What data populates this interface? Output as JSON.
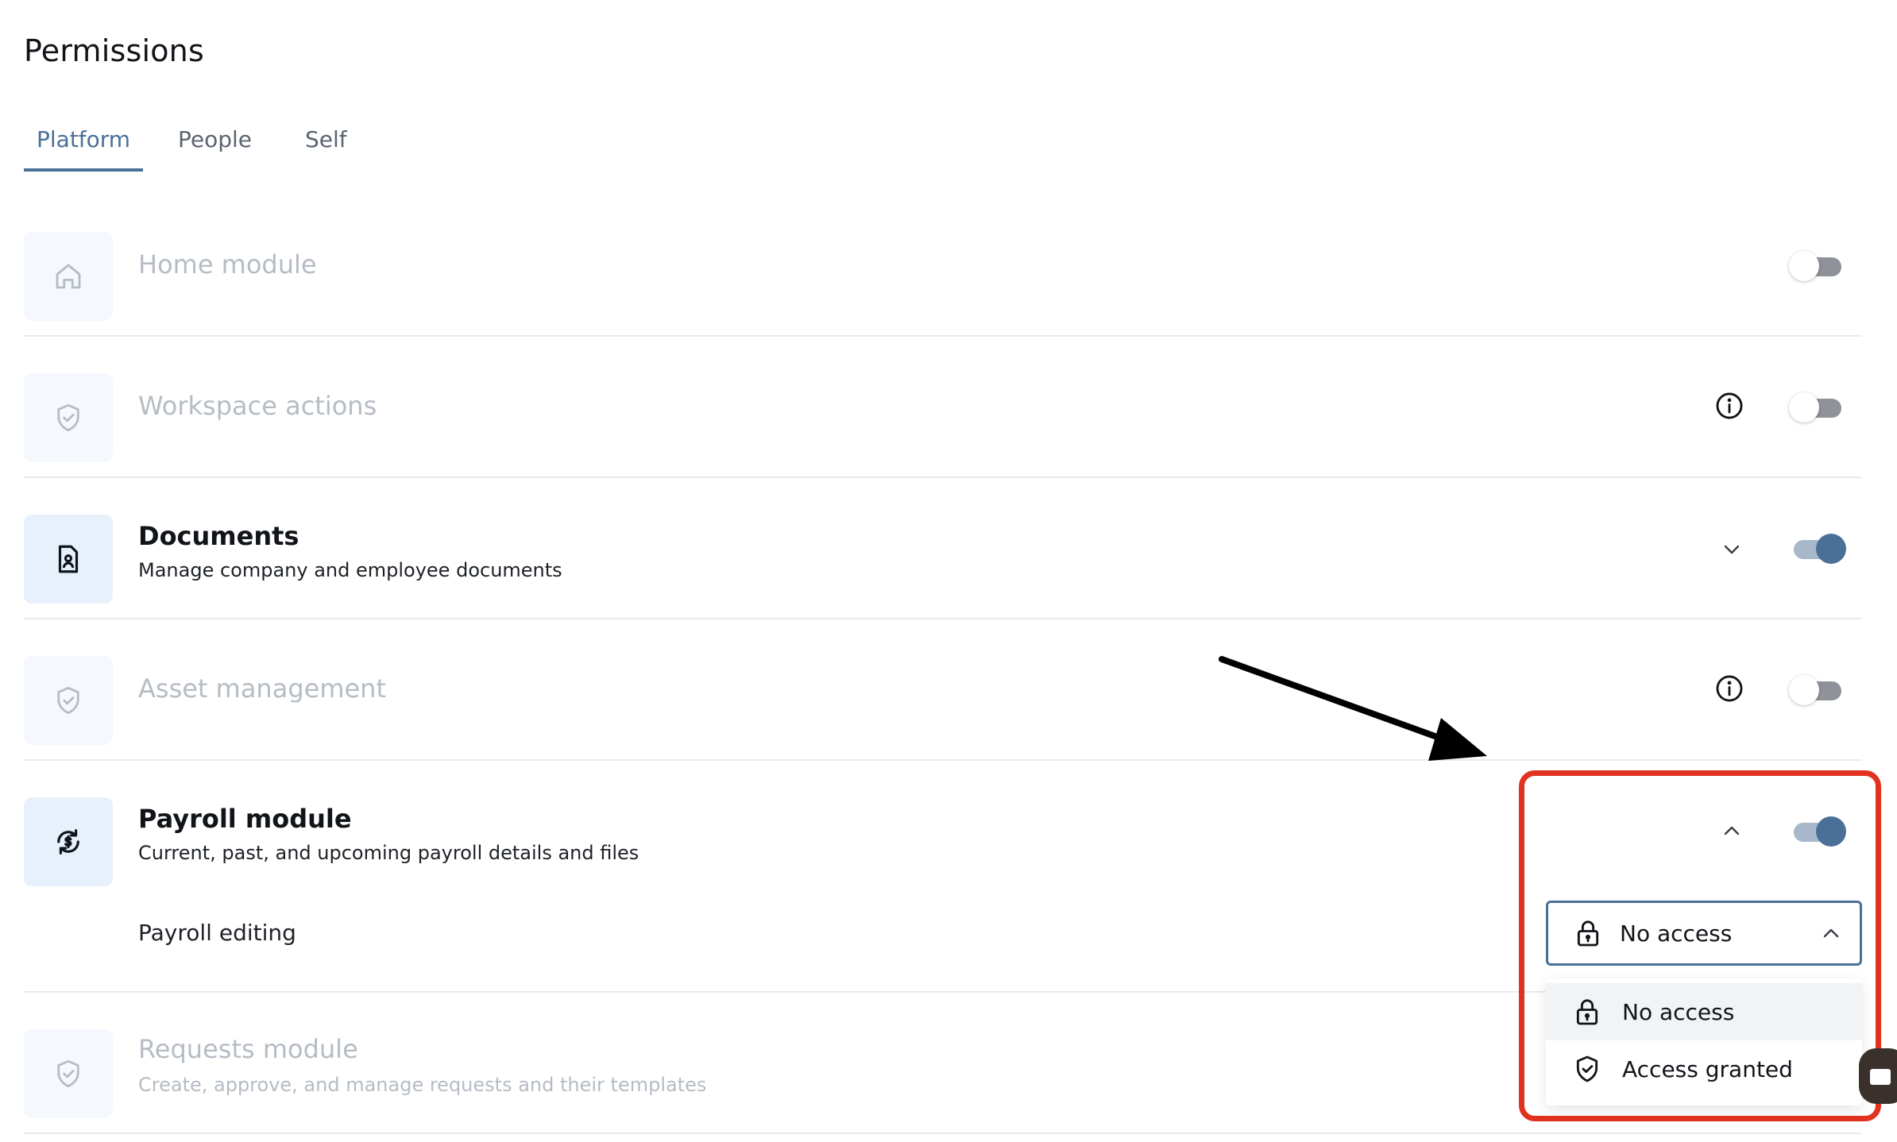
{
  "page": {
    "title": "Permissions"
  },
  "tabs": [
    {
      "label": "Platform",
      "active": true
    },
    {
      "label": "People",
      "active": false
    },
    {
      "label": "Self",
      "active": false
    }
  ],
  "modules": [
    {
      "name": "Home module",
      "description": "",
      "icon": "home-icon",
      "enabled": false,
      "control": "none"
    },
    {
      "name": "Workspace actions",
      "description": "",
      "icon": "shield-check-icon",
      "enabled": false,
      "control": "info"
    },
    {
      "name": "Documents",
      "description": "Manage company and employee documents",
      "icon": "document-person-icon",
      "enabled": true,
      "control": "chevron-down"
    },
    {
      "name": "Asset management",
      "description": "",
      "icon": "shield-check-icon",
      "enabled": false,
      "control": "info"
    },
    {
      "name": "Payroll module",
      "description": "Current, past, and upcoming payroll details and files",
      "icon": "payroll-refresh-icon",
      "enabled": true,
      "control": "chevron-up"
    },
    {
      "name": "Requests module",
      "description": "Create, approve, and manage requests and their templates",
      "icon": "shield-check-icon",
      "enabled": false,
      "control": "none"
    }
  ],
  "payroll_sub": {
    "label": "Payroll editing",
    "selected": "No access",
    "selected_icon": "lock-icon",
    "options": [
      {
        "label": "No access",
        "icon": "lock-icon",
        "highlighted": true
      },
      {
        "label": "Access granted",
        "icon": "shield-check-icon",
        "highlighted": false
      }
    ]
  },
  "annotation": {
    "arrow_color": "#000000",
    "box_color": "#e0321f"
  },
  "colors": {
    "accent": "#4a7098",
    "disabled_text": "#b6bcc4",
    "divider": "#e8ebef"
  }
}
